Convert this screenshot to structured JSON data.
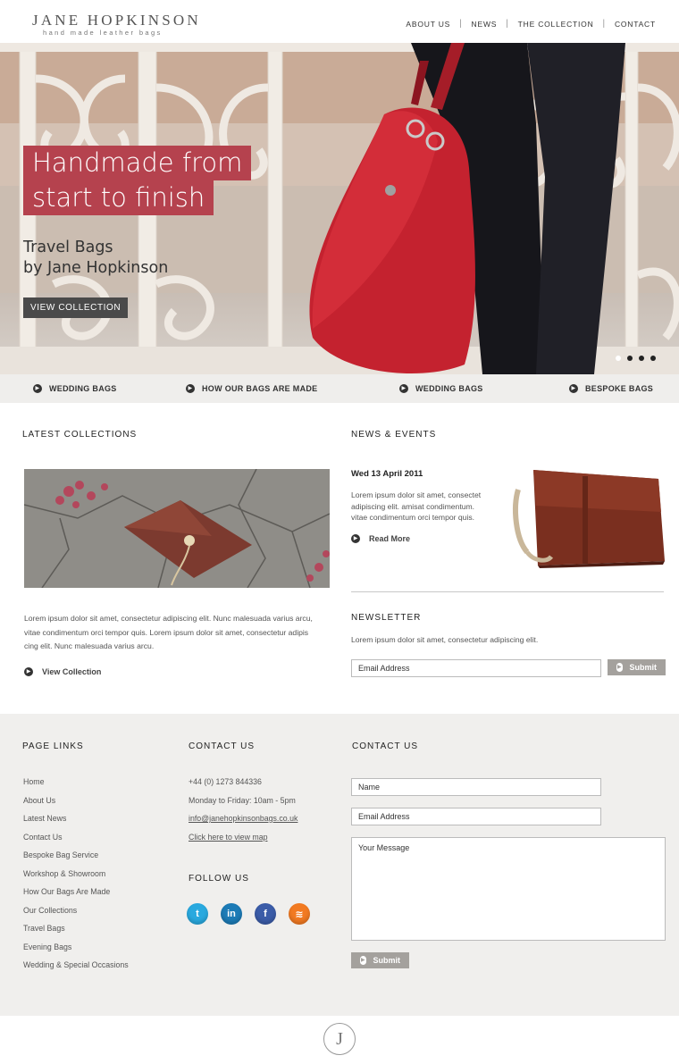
{
  "header": {
    "logo_name": "JANE HOPKINSON",
    "logo_tagline": "hand made leather bags",
    "nav": [
      "ABOUT US",
      "NEWS",
      "THE COLLECTION",
      "CONTACT"
    ]
  },
  "hero": {
    "title_line1": "Handmade from",
    "title_line2": "start to finish",
    "subtitle_line1": "Travel Bags",
    "subtitle_line2": "by Jane Hopkinson",
    "button": "VIEW COLLECTION",
    "slides_count": 4,
    "active_slide": 1
  },
  "quicklinks": [
    "WEDDING BAGS",
    "HOW OUR BAGS ARE MADE",
    "WEDDING BAGS",
    "BESPOKE BAGS"
  ],
  "latest": {
    "title": "LATEST COLLECTIONS",
    "text_line1": "Lorem ipsum dolor sit amet, consectetur adipiscing elit. Nunc malesuada varius arcu,",
    "text_line2": "vitae condimentum orci tempor quis. Lorem ipsum dolor sit amet, consectetur adipis",
    "text_line3": "cing elit. Nunc malesuada varius arcu.",
    "link": "View Collection"
  },
  "news": {
    "title": "NEWS & EVENTS",
    "date": "Wed 13 April 2011",
    "text_line1": "Lorem ipsum dolor sit amet, consectet",
    "text_line2": "adipiscing elit. amisat condimentum.",
    "text_line3": "vitae condimentum orci tempor quis.",
    "link": "Read More"
  },
  "newsletter": {
    "title": "NEWSLETTER",
    "text": "Lorem ipsum dolor sit amet, consectetur adipiscing elit.",
    "email_value": "Email Address",
    "submit": "Submit"
  },
  "footer": {
    "page_links_title": "PAGE LINKS",
    "page_links": [
      "Home",
      "About Us",
      "Latest News",
      "Contact Us",
      "Bespoke Bag Service",
      "Workshop & Showroom",
      "How Our Bags Are Made",
      "Our Collections",
      "Travel Bags",
      "Evening Bags",
      "Wedding & Special Occasions"
    ],
    "contact_title": "CONTACT US",
    "phone": "+44 (0) 1273 844336",
    "hours": "Monday to Friday: 10am - 5pm",
    "email": "info@janehopkinsonbags.co.uk",
    "map_link": "Click here to view map",
    "follow_title": "FOLLOW US",
    "form_title": "CONTACT US",
    "name_value": "Name",
    "email_value": "Email Address",
    "message_value": "Your Message",
    "submit": "Submit"
  },
  "colors": {
    "accent": "#b5424e",
    "footer_bg": "#f0efed",
    "button_grey": "#a4a19d"
  }
}
